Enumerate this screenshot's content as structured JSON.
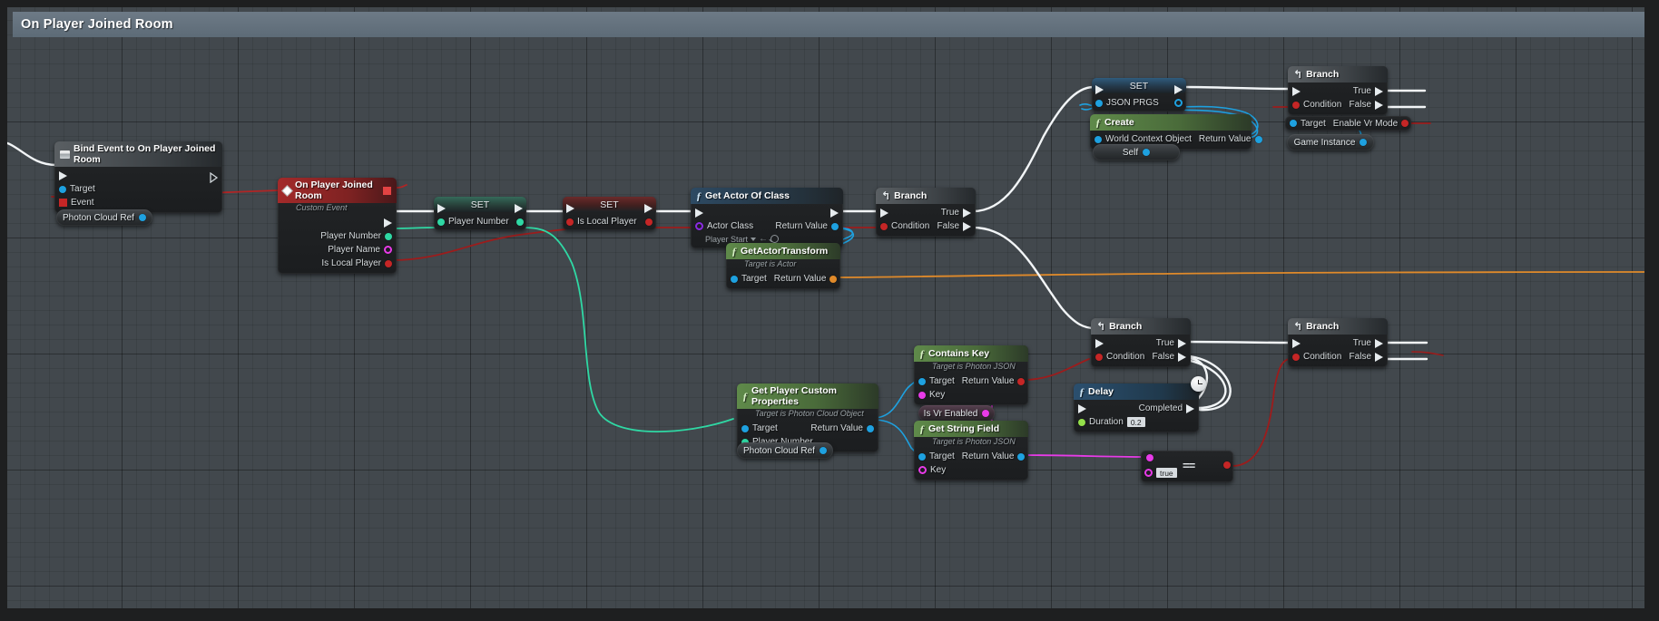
{
  "graph": {
    "title": "On Player Joined Room",
    "background_color": "#42484d",
    "title_bar_color": "#6d7a86"
  },
  "wire_colors": {
    "exec": "#f2f5f7",
    "bool": "#9c1c1c",
    "object": "#1ea1e0",
    "int": "#2fd8a4",
    "string": "#e83be8",
    "struct_orange": "#e08a2a"
  },
  "nodes": [
    {
      "id": "bind_event",
      "title": "Bind Event to On Player Joined Room",
      "icon": "book-icon",
      "header_style": "grey",
      "inputs": [
        {
          "label": "Target",
          "pin": "object"
        },
        {
          "label": "Event",
          "pin": "delegate"
        }
      ],
      "outputs": []
    },
    {
      "id": "photon_cloud_ref_1",
      "title": "Photon Cloud Ref",
      "type": "variable-get-pill"
    },
    {
      "id": "on_player_joined_room",
      "title": "On Player Joined Room",
      "subtitle": "Custom Event",
      "header_style": "red",
      "outputs": [
        {
          "label": "Player Number",
          "pin": "int"
        },
        {
          "label": "Player Name",
          "pin": "string"
        },
        {
          "label": "Is Local Player",
          "pin": "bool"
        }
      ]
    },
    {
      "id": "set_player_number",
      "title": "SET",
      "header_style": "green",
      "pins": [
        {
          "label": "Player Number",
          "pin": "int"
        }
      ]
    },
    {
      "id": "set_is_local_player",
      "title": "SET",
      "header_style": "red",
      "pins": [
        {
          "label": "Is Local Player",
          "pin": "bool"
        }
      ]
    },
    {
      "id": "get_actor_of_class",
      "title": "Get Actor Of Class",
      "header_style": "fn",
      "inputs": [
        {
          "label": "Actor Class",
          "pin": "class",
          "value": "Player Start"
        }
      ],
      "outputs": [
        {
          "label": "Return Value",
          "pin": "object"
        }
      ]
    },
    {
      "id": "get_actor_transform",
      "title": "GetActorTransform",
      "subtitle": "Target is Actor",
      "header_style": "green",
      "inputs": [
        {
          "label": "Target",
          "pin": "object"
        }
      ],
      "outputs": [
        {
          "label": "Return Value",
          "pin": "struct"
        }
      ]
    },
    {
      "id": "branch_1",
      "title": "Branch",
      "header_style": "grey",
      "inputs": [
        {
          "label": "Condition",
          "pin": "bool"
        }
      ],
      "outputs": [
        {
          "label": "True",
          "pin": "exec"
        },
        {
          "label": "False",
          "pin": "exec"
        }
      ]
    },
    {
      "id": "set_json_prgs",
      "title": "SET",
      "header_style": "blue",
      "pins": [
        {
          "label": "JSON PRGS",
          "pin": "object"
        }
      ]
    },
    {
      "id": "create_json",
      "title": "Create",
      "header_style": "green",
      "inputs": [
        {
          "label": "World Context Object",
          "pin": "object"
        }
      ],
      "outputs": [
        {
          "label": "Return Value",
          "pin": "object"
        }
      ]
    },
    {
      "id": "self_pill",
      "title": "Self",
      "type": "variable-get-pill"
    },
    {
      "id": "branch_2",
      "title": "Branch",
      "header_style": "grey",
      "inputs": [
        {
          "label": "Condition",
          "pin": "bool"
        }
      ],
      "outputs": [
        {
          "label": "True",
          "pin": "exec"
        },
        {
          "label": "False",
          "pin": "exec"
        }
      ]
    },
    {
      "id": "enable_vr_mode",
      "title": "Enable Vr Mode",
      "inputs": [
        {
          "label": "Target",
          "pin": "object"
        }
      ]
    },
    {
      "id": "game_instance_pill",
      "title": "Game Instance",
      "type": "variable-get-pill"
    },
    {
      "id": "get_player_custom_properties",
      "title": "Get Player Custom Properties",
      "subtitle": "Target is Photon Cloud Object",
      "header_style": "green",
      "inputs": [
        {
          "label": "Target",
          "pin": "object"
        },
        {
          "label": "Player Number",
          "pin": "int"
        }
      ],
      "outputs": [
        {
          "label": "Return Value",
          "pin": "object"
        }
      ]
    },
    {
      "id": "photon_cloud_ref_2",
      "title": "Photon Cloud Ref",
      "type": "variable-get-pill"
    },
    {
      "id": "contains_key",
      "title": "Contains Key",
      "subtitle": "Target is Photon JSON",
      "header_style": "green",
      "inputs": [
        {
          "label": "Target",
          "pin": "object"
        },
        {
          "label": "Key",
          "pin": "string"
        }
      ],
      "outputs": [
        {
          "label": "Return Value",
          "pin": "bool"
        }
      ]
    },
    {
      "id": "is_vr_enabled_pill_1",
      "title": "Is Vr Enabled",
      "type": "variable-get-pill"
    },
    {
      "id": "get_string_field",
      "title": "Get String Field",
      "subtitle": "Target is Photon JSON",
      "header_style": "green",
      "inputs": [
        {
          "label": "Target",
          "pin": "object"
        },
        {
          "label": "Key",
          "pin": "string"
        }
      ],
      "outputs": [
        {
          "label": "Return Value",
          "pin": "string"
        }
      ]
    },
    {
      "id": "branch_3",
      "title": "Branch",
      "header_style": "grey",
      "inputs": [
        {
          "label": "Condition",
          "pin": "bool"
        }
      ],
      "outputs": [
        {
          "label": "True",
          "pin": "exec"
        },
        {
          "label": "False",
          "pin": "exec"
        }
      ]
    },
    {
      "id": "delay",
      "title": "Delay",
      "header_style": "blue",
      "icon": "clock-icon",
      "inputs": [
        {
          "label": "Duration",
          "pin": "float",
          "value": "0.2"
        }
      ],
      "outputs": [
        {
          "label": "Completed",
          "pin": "exec"
        }
      ]
    },
    {
      "id": "equal_string",
      "title": "==",
      "inputs": [
        {
          "label": "",
          "pin": "string"
        },
        {
          "label": "",
          "pin": "string",
          "value": "true"
        }
      ],
      "outputs": [
        {
          "label": "",
          "pin": "bool"
        }
      ]
    },
    {
      "id": "branch_4",
      "title": "Branch",
      "header_style": "grey",
      "inputs": [
        {
          "label": "Condition",
          "pin": "bool"
        }
      ],
      "outputs": [
        {
          "label": "True",
          "pin": "exec"
        },
        {
          "label": "False",
          "pin": "exec"
        }
      ]
    }
  ],
  "labels": {
    "target": "Target",
    "event": "Event",
    "player_number": "Player Number",
    "player_name": "Player Name",
    "is_local_player": "Is Local Player",
    "actor_class": "Actor Class",
    "player_start": "Player Start",
    "return_value": "Return Value",
    "condition": "Condition",
    "true": "True",
    "false": "False",
    "json_prgs": "JSON PRGS",
    "world_context_object": "World Context Object",
    "self": "Self",
    "enable_vr_mode": "Enable Vr Mode",
    "game_instance": "Game Instance",
    "key": "Key",
    "is_vr_enabled": "Is Vr Enabled",
    "completed": "Completed",
    "duration": "Duration",
    "duration_value": "0.2",
    "true_literal": "true",
    "photon_cloud_ref": "Photon Cloud Ref",
    "set": "SET",
    "custom_event": "Custom Event",
    "target_is_actor": "Target is Actor",
    "target_is_photon_cloud_object": "Target is Photon Cloud Object",
    "target_is_photon_json": "Target is Photon JSON",
    "bind_event_title": "Bind Event to On Player Joined Room",
    "on_player_joined_room": "On Player Joined Room",
    "get_actor_of_class": "Get Actor Of Class",
    "get_actor_transform": "GetActorTransform",
    "branch": "Branch",
    "create": "Create",
    "get_player_custom_properties": "Get Player Custom Properties",
    "contains_key": "Contains Key",
    "get_string_field": "Get String Field",
    "delay": "Delay",
    "equals": "=="
  }
}
